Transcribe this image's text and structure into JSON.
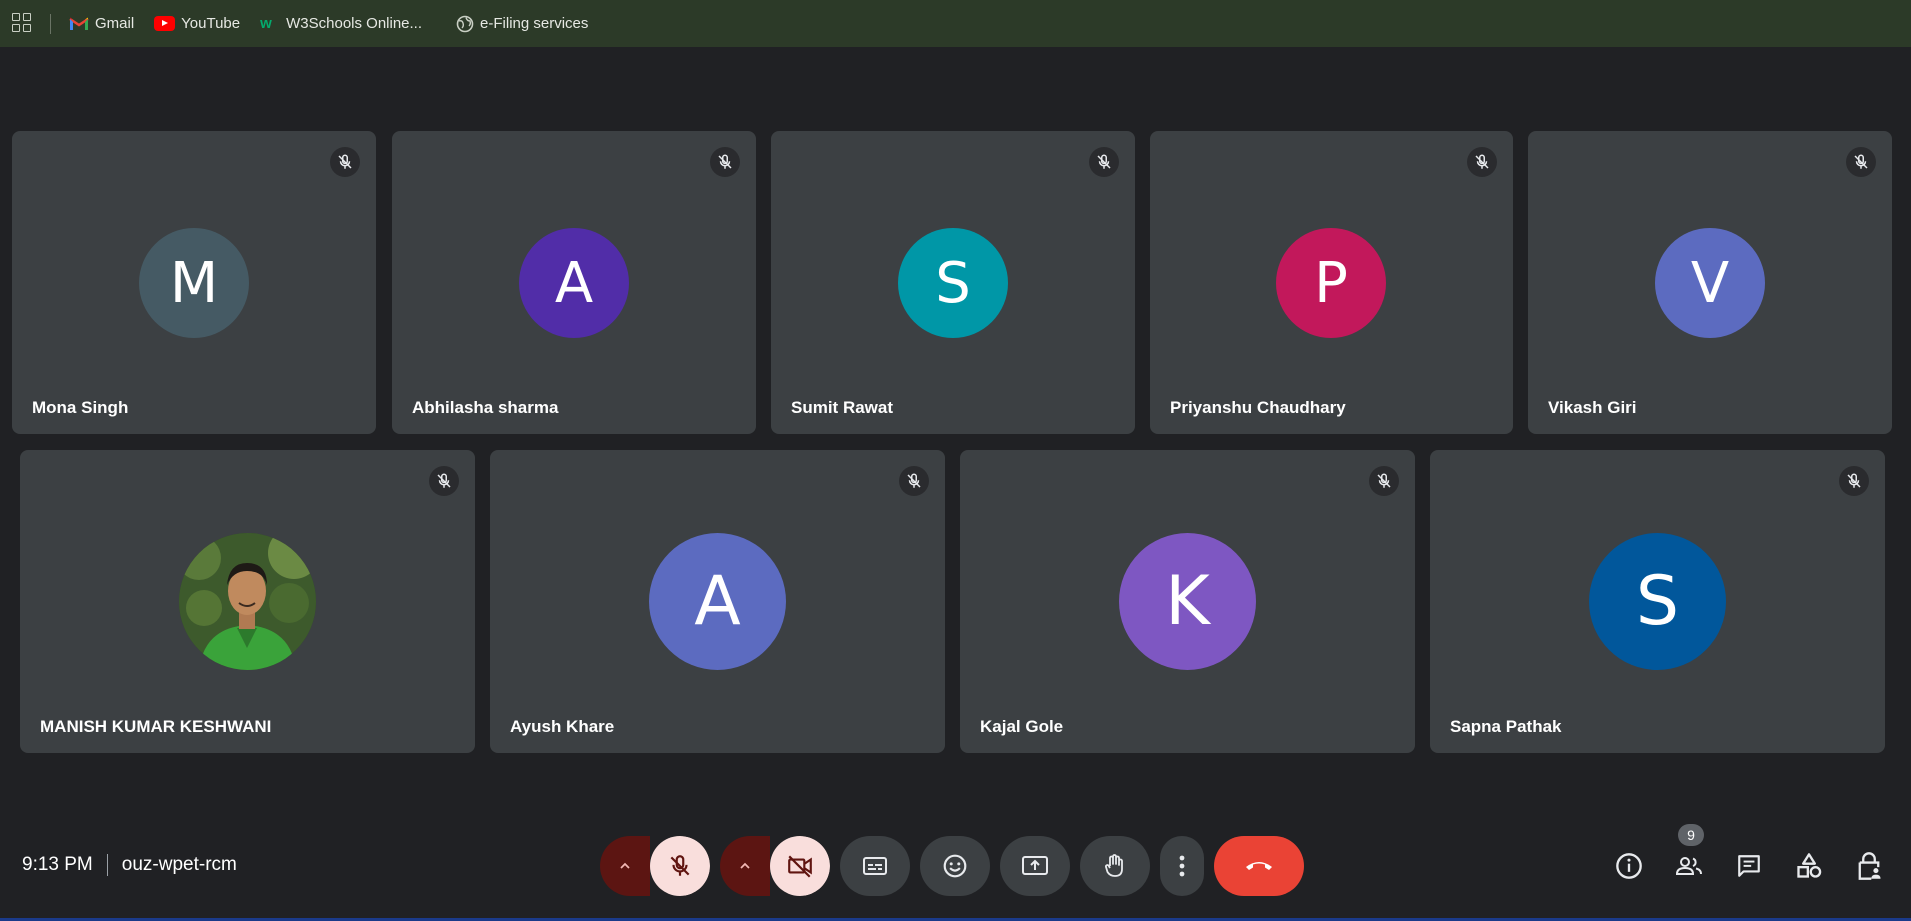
{
  "bookmarks": [
    {
      "label": "Gmail",
      "icon": "gmail-icon"
    },
    {
      "label": "YouTube",
      "icon": "youtube-icon"
    },
    {
      "label": "W3Schools Online...",
      "icon": "w3schools-icon"
    },
    {
      "label": "e-Filing services",
      "icon": "globe-icon"
    }
  ],
  "participants": [
    {
      "name": "Mona Singh",
      "initial": "M",
      "color": "#455a64",
      "muted": true
    },
    {
      "name": "Abhilasha sharma",
      "initial": "A",
      "color": "#512da8",
      "muted": true
    },
    {
      "name": "Sumit Rawat",
      "initial": "S",
      "color": "#0097a7",
      "muted": true
    },
    {
      "name": "Priyanshu Chaudhary",
      "initial": "P",
      "color": "#c2185b",
      "muted": true
    },
    {
      "name": "Vikash Giri",
      "initial": "V",
      "color": "#5c6bc0",
      "muted": true
    },
    {
      "name": "MANISH KUMAR KESHWANI",
      "initial": "",
      "color": "#4a7a3a",
      "muted": true,
      "photo": true
    },
    {
      "name": "Ayush Khare",
      "initial": "A",
      "color": "#5c6bc0",
      "muted": true
    },
    {
      "name": "Kajal Gole",
      "initial": "K",
      "color": "#7e57c2",
      "muted": true
    },
    {
      "name": "Sapna Pathak",
      "initial": "S",
      "color": "#01579b",
      "muted": true
    }
  ],
  "meeting": {
    "time": "9:13 PM",
    "code": "ouz-wpet-rcm"
  },
  "people_count": "9",
  "colors": {
    "end_call": "#ea4335",
    "muted_bg": "#f9dedc",
    "muted_chevron": "#5c1512",
    "tile_bg": "#3c4043"
  }
}
